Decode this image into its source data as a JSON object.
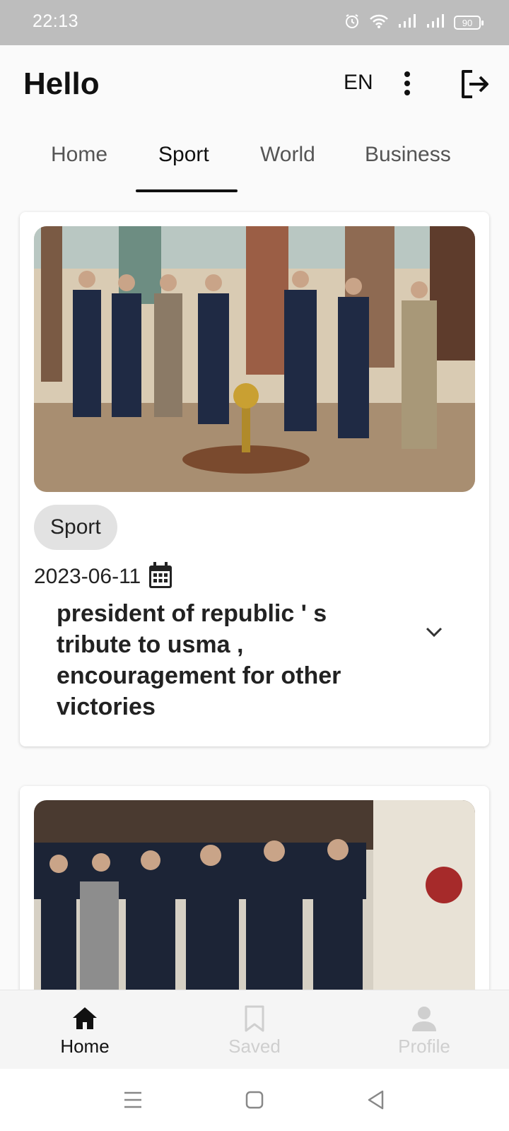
{
  "status_bar": {
    "time": "22:13",
    "battery": "90",
    "icons": [
      "alarm-icon",
      "wifi-icon",
      "signal-icon",
      "signal-icon",
      "battery-icon"
    ]
  },
  "header": {
    "greeting": "Hello",
    "language": "EN",
    "icons": [
      "more-vert-icon",
      "logout-icon"
    ]
  },
  "tabs": [
    {
      "label": "Home",
      "active": false
    },
    {
      "label": "Sport",
      "active": true
    },
    {
      "label": "World",
      "active": false
    },
    {
      "label": "Business",
      "active": false
    }
  ],
  "articles": [
    {
      "category": "Sport",
      "date": "2023-06-11",
      "title": "president of republic ' s tribute to usma , encouragement for other victories",
      "icons": [
        "calendar-icon",
        "chevron-down-icon"
      ]
    },
    {
      "category": "",
      "date": "",
      "title": ""
    }
  ],
  "bottom_nav": [
    {
      "label": "Home",
      "icon": "home-icon",
      "active": true
    },
    {
      "label": "Saved",
      "icon": "bookmark-icon",
      "active": false
    },
    {
      "label": "Profile",
      "icon": "person-icon",
      "active": false
    }
  ],
  "system_nav": {
    "icons": [
      "menu-icon",
      "home-square-icon",
      "back-icon"
    ]
  },
  "colors": {
    "status_bar": "#bdbdbd",
    "background": "#fafafa",
    "active": "#111111",
    "inactive_nav": "#cfcfcf",
    "chip": "#e2e2e2"
  }
}
